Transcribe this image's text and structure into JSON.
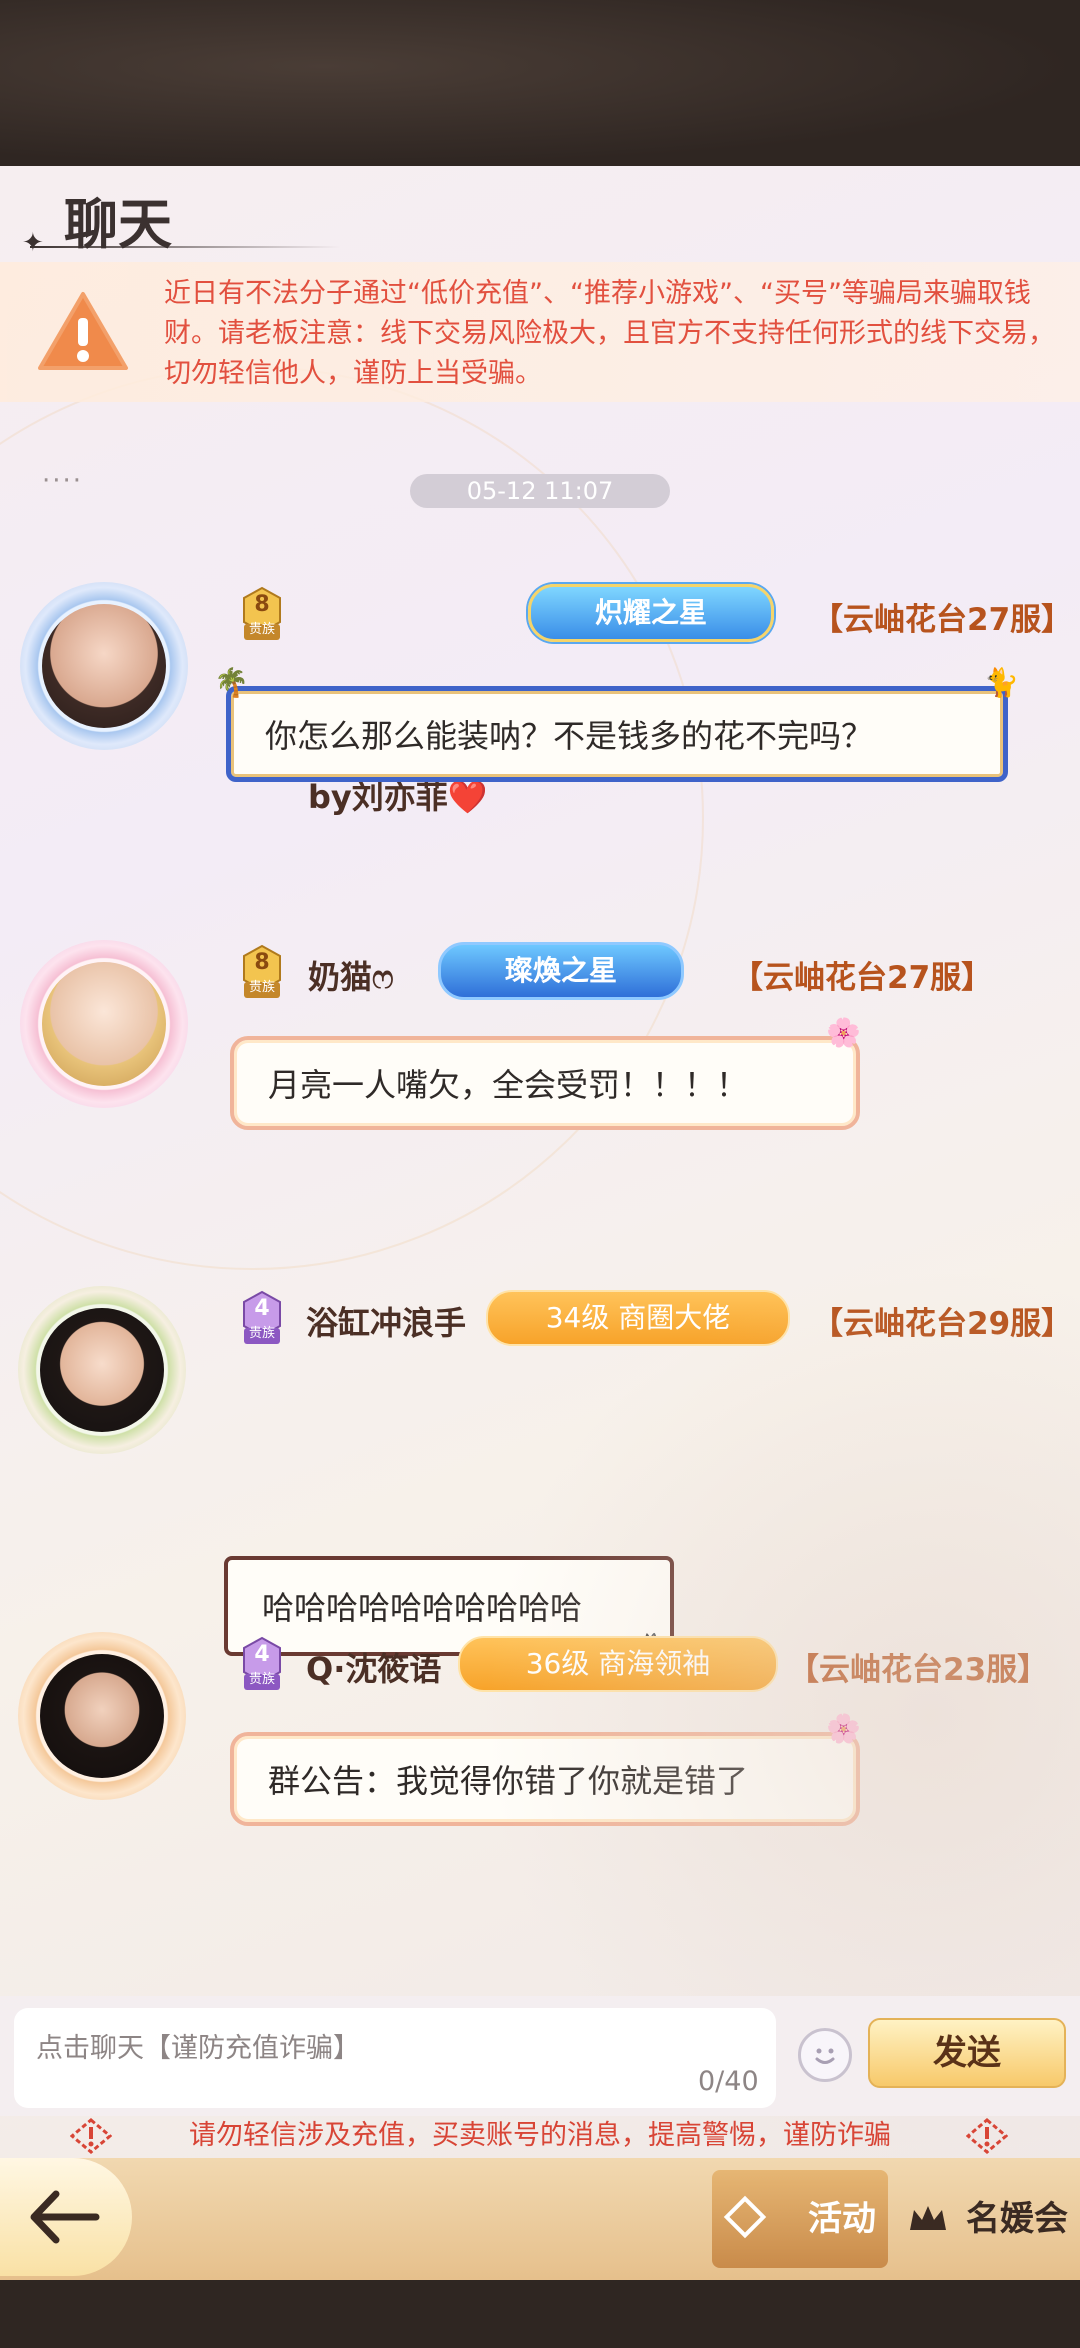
{
  "header": {
    "title": "聊天"
  },
  "warning": {
    "text": "近日有不法分子通过“低价充值”、“推荐小游戏”、“买号”等骗局来骗取钱财。请老板注意：线下交易风险极大，且官方不支持任何形式的线下交易，切勿轻信他人，谨防上当受骗。"
  },
  "timestamp": "05-12 11:07",
  "messages": [
    {
      "badge_level": "8",
      "badge_label": "贵族",
      "name": "by刘亦菲❤️",
      "title_tag": "炽耀之星",
      "server": "【云岫花台27服】",
      "text": "你怎么那么能装呐？不是钱多的花不完吗？"
    },
    {
      "badge_level": "8",
      "badge_label": "贵族",
      "name": "奶猫ෆ",
      "title_tag": "璨煥之星",
      "server": "【云岫花台27服】",
      "text": "月亮一人嘴欠，全会受罚！！！！"
    },
    {
      "badge_level": "4",
      "badge_label": "贵族",
      "name": "浴缸冲浪手",
      "title_tag": "34级 商圈大佬",
      "server": "【云岫花台29服】",
      "text": "哈哈哈哈哈哈哈哈哈哈"
    },
    {
      "badge_level": "4",
      "badge_label": "贵族",
      "name": "Q·沈筱语",
      "title_tag": "36级 商海领袖",
      "server": "【云岫花台23服】",
      "text": "群公告：我觉得你错了你就是错了"
    }
  ],
  "input": {
    "placeholder": "点击聊天【谨防充值诈骗】",
    "char_count": "0/40",
    "send_label": "发送"
  },
  "fraud_tip": "请勿轻信涉及充值，买卖账号的消息，提高警惕，谨防诈骗",
  "nav": {
    "activity_label": "活动",
    "mingyuan_label": "名媛会"
  },
  "colors": {
    "warning_text": "#e2503f",
    "server_text": "#b7531d",
    "send_button": "#f7c96a"
  }
}
